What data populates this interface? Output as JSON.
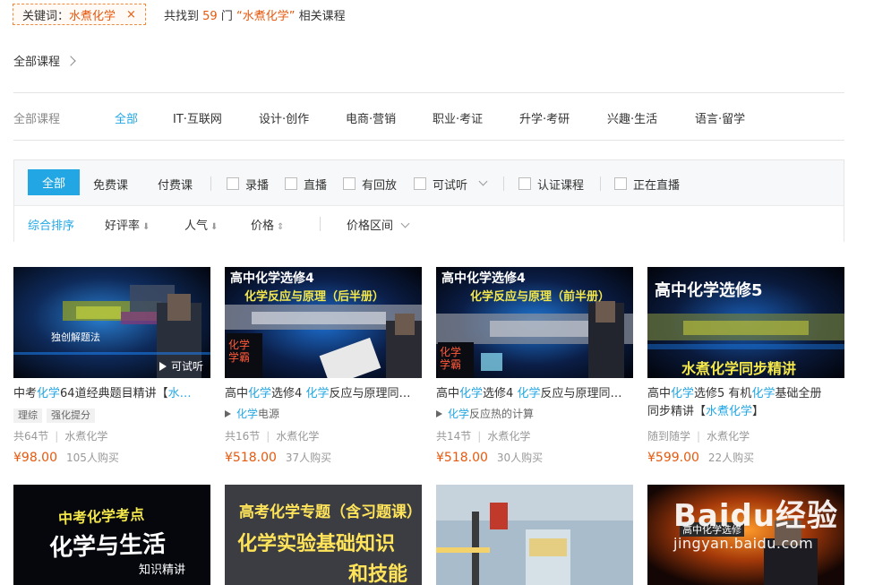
{
  "search": {
    "keyword_label": "关键词：",
    "keyword": "水煮化学",
    "close": "×",
    "found_prefix": "共找到",
    "count": "59",
    "found_mid": "门",
    "quoted_keyword": "“水煮化学”",
    "found_suffix": "相关课程"
  },
  "breadcrumb": {
    "label": "全部课程"
  },
  "categories": {
    "label": "全部课程",
    "items": [
      "全部",
      "IT·互联网",
      "设计·创作",
      "电商·营销",
      "职业·考证",
      "升学·考研",
      "兴趣·生活",
      "语言·留学"
    ]
  },
  "filters": {
    "all": "全部",
    "free": "免费课",
    "paid": "付费课",
    "recorded": "录播",
    "live": "直播",
    "replay": "有回放",
    "trial": "可试听",
    "certified": "认证课程",
    "live_now": "正在直播"
  },
  "sort": {
    "default": "综合排序",
    "rating": "好评率",
    "popularity": "人气",
    "price": "价格",
    "price_range": "价格区间"
  },
  "courses": [
    {
      "title_parts": [
        "中考",
        "化学",
        "64道经典题目精讲【",
        "水…"
      ],
      "tags": [
        "理综",
        "强化提分"
      ],
      "lessons": "共64节",
      "teacher": "水煮化学",
      "price": "¥98.00",
      "buyers": "105人购买",
      "trial": "可试听",
      "thumb_text": "独创解题法"
    },
    {
      "title_parts": [
        "高中",
        "化学",
        "选修4 ",
        "化学",
        "反应与原理同…"
      ],
      "sub_parts": [
        "",
        "化学",
        "电源"
      ],
      "lessons": "共16节",
      "teacher": "水煮化学",
      "price": "¥518.00",
      "buyers": "37人购买",
      "thumb_line1": "高中化学选修4",
      "thumb_line2": "化学反应与原理（后半册）",
      "thumb_side": "化学学霸"
    },
    {
      "title_parts": [
        "高中",
        "化学",
        "选修4 ",
        "化学",
        "反应与原理同…"
      ],
      "sub_parts": [
        "",
        "化学",
        "反应热的计算"
      ],
      "lessons": "共14节",
      "teacher": "水煮化学",
      "price": "¥518.00",
      "buyers": "30人购买",
      "thumb_line1": "高中化学选修4",
      "thumb_line2": "化学反应与原理（前半册）",
      "thumb_side": "化学学霸"
    },
    {
      "title_line1_parts": [
        "高中",
        "化学",
        "选修5 有机",
        "化学",
        "基础全册"
      ],
      "title_line2_parts": [
        "同步精讲【",
        "水煮化学",
        "】"
      ],
      "lessons": "随到随学",
      "teacher": "水煮化学",
      "price": "¥599.00",
      "buyers": "22人购买",
      "thumb_line1": "高中化学选修5",
      "thumb_line2": "水煮化学同步精讲"
    }
  ],
  "row2_thumbs": {
    "t1_line1": "中考化学考点",
    "t1_line2": "化学与生活",
    "t1_line3": "知识精讲",
    "t2_line1": "高考化学专题（含习题课）",
    "t2_line2": "化学实验基础知识",
    "t2_line3": "和技能",
    "t4_label": "高中化学选修"
  },
  "watermark": {
    "brand": "Baidu经验",
    "url": "jingyan.baidu.com"
  },
  "colors": {
    "accent_blue": "#23a7e4",
    "accent_orange": "#e6590e"
  }
}
